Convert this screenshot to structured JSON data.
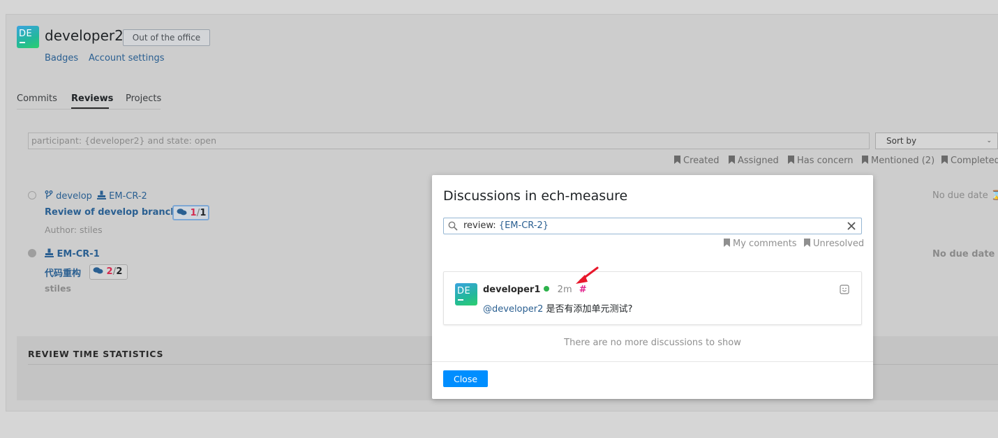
{
  "profile": {
    "avatar_initials": "DE",
    "username": "developer2",
    "status_button": "Out of the office",
    "links": [
      "Badges",
      "Account settings"
    ]
  },
  "tabs": [
    "Commits",
    "Reviews",
    "Projects"
  ],
  "active_tab": "Reviews",
  "search": {
    "query": "participant: {developer2} and state: open"
  },
  "sort": {
    "label": "Sort by"
  },
  "filters": [
    "Created",
    "Assigned",
    "Has concern",
    "Mentioned (2)",
    "Completed"
  ],
  "reviews": [
    {
      "branch": "develop",
      "id": "EM-CR-2",
      "title": "Review of develop branch",
      "comments_unread": "1",
      "comments_total": "1",
      "author": "Author: stiles",
      "due": "No due date"
    },
    {
      "id": "EM-CR-1",
      "title": "代码重构",
      "comments_unread": "2",
      "comments_total": "2",
      "author": "stiles",
      "due": "No due date"
    }
  ],
  "stats": {
    "title": "REVIEW TIME STATISTICS"
  },
  "modal": {
    "title": "Discussions in ech-measure",
    "search_prefix": "review: ",
    "search_token": "{EM-CR-2}",
    "filters": [
      "My comments",
      "Unresolved"
    ],
    "discussion": {
      "avatar_initials": "DE",
      "author": "developer1",
      "time": "2m",
      "hash": "#",
      "mention": "@developer2",
      "text": " 是否有添加单元测试?"
    },
    "no_more": "There are no more discussions to show",
    "close_label": "Close"
  },
  "colors": {
    "accent": "#008eff",
    "link": "#2a5f91",
    "unread": "#d22b4f",
    "hash": "#e0208c",
    "online": "#2db24b",
    "arrow": "#e8182b"
  }
}
